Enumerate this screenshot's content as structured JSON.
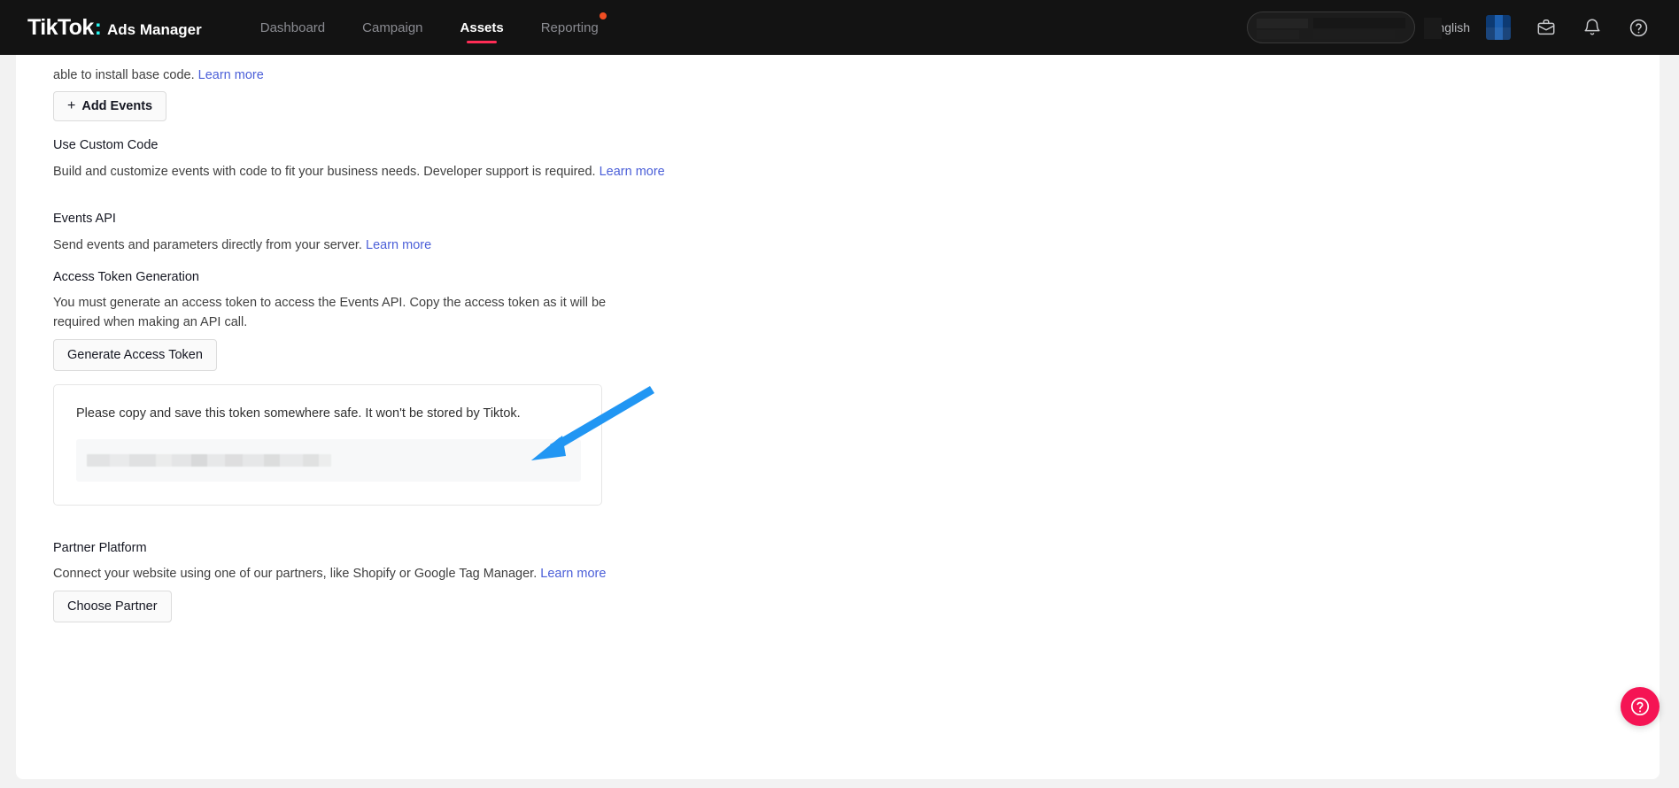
{
  "header": {
    "brand_logo": "TikTok",
    "brand_colon": ":",
    "brand_sub": "Ads Manager",
    "nav": [
      {
        "label": "Dashboard",
        "active": false,
        "dot": false
      },
      {
        "label": "Campaign",
        "active": false,
        "dot": false
      },
      {
        "label": "Assets",
        "active": true,
        "dot": false
      },
      {
        "label": "Reporting",
        "active": false,
        "dot": true
      }
    ],
    "account_pill_value": "",
    "language": "English",
    "icons": {
      "avatar": "avatar-square",
      "inbox": "briefcase-icon",
      "notifications": "bell-icon",
      "help": "help-circle-icon"
    },
    "colors": {
      "bar_bg": "#131313",
      "active_underline": "#fe2c55",
      "brand_cyan": "#25f4ee",
      "nav_dot": "#f04e23"
    }
  },
  "main": {
    "base_code_line": "able to install base code.",
    "base_code_link": "Learn more",
    "add_events_button": "Add Events",
    "add_events_plus": "+",
    "custom_code_title": "Use Custom Code",
    "custom_code_desc": "Build and customize events with code to fit your business needs. Developer support is required.",
    "custom_code_link": "Learn more",
    "events_api_title": "Events API",
    "events_api_desc": "Send events and parameters directly from your server.",
    "events_api_link": "Learn more",
    "token_gen_title": "Access Token Generation",
    "token_gen_desc": "You must generate an access token to access the Events API. Copy the access token as it will be required when making an API call.",
    "generate_button": "Generate Access Token",
    "token_card": {
      "note": "Please copy and save this token somewhere safe. It won't be stored by Tiktok.",
      "token_value": ""
    },
    "partner_title": "Partner Platform",
    "partner_desc": "Connect your website using one of our partners, like Shopify or Google Tag Manager.",
    "partner_link": "Learn more",
    "choose_partner_button": "Choose Partner"
  },
  "annotation": {
    "arrow_color": "#2196f3",
    "points_to": "token-field"
  },
  "fab": {
    "label": "?",
    "color": "#f51454"
  }
}
